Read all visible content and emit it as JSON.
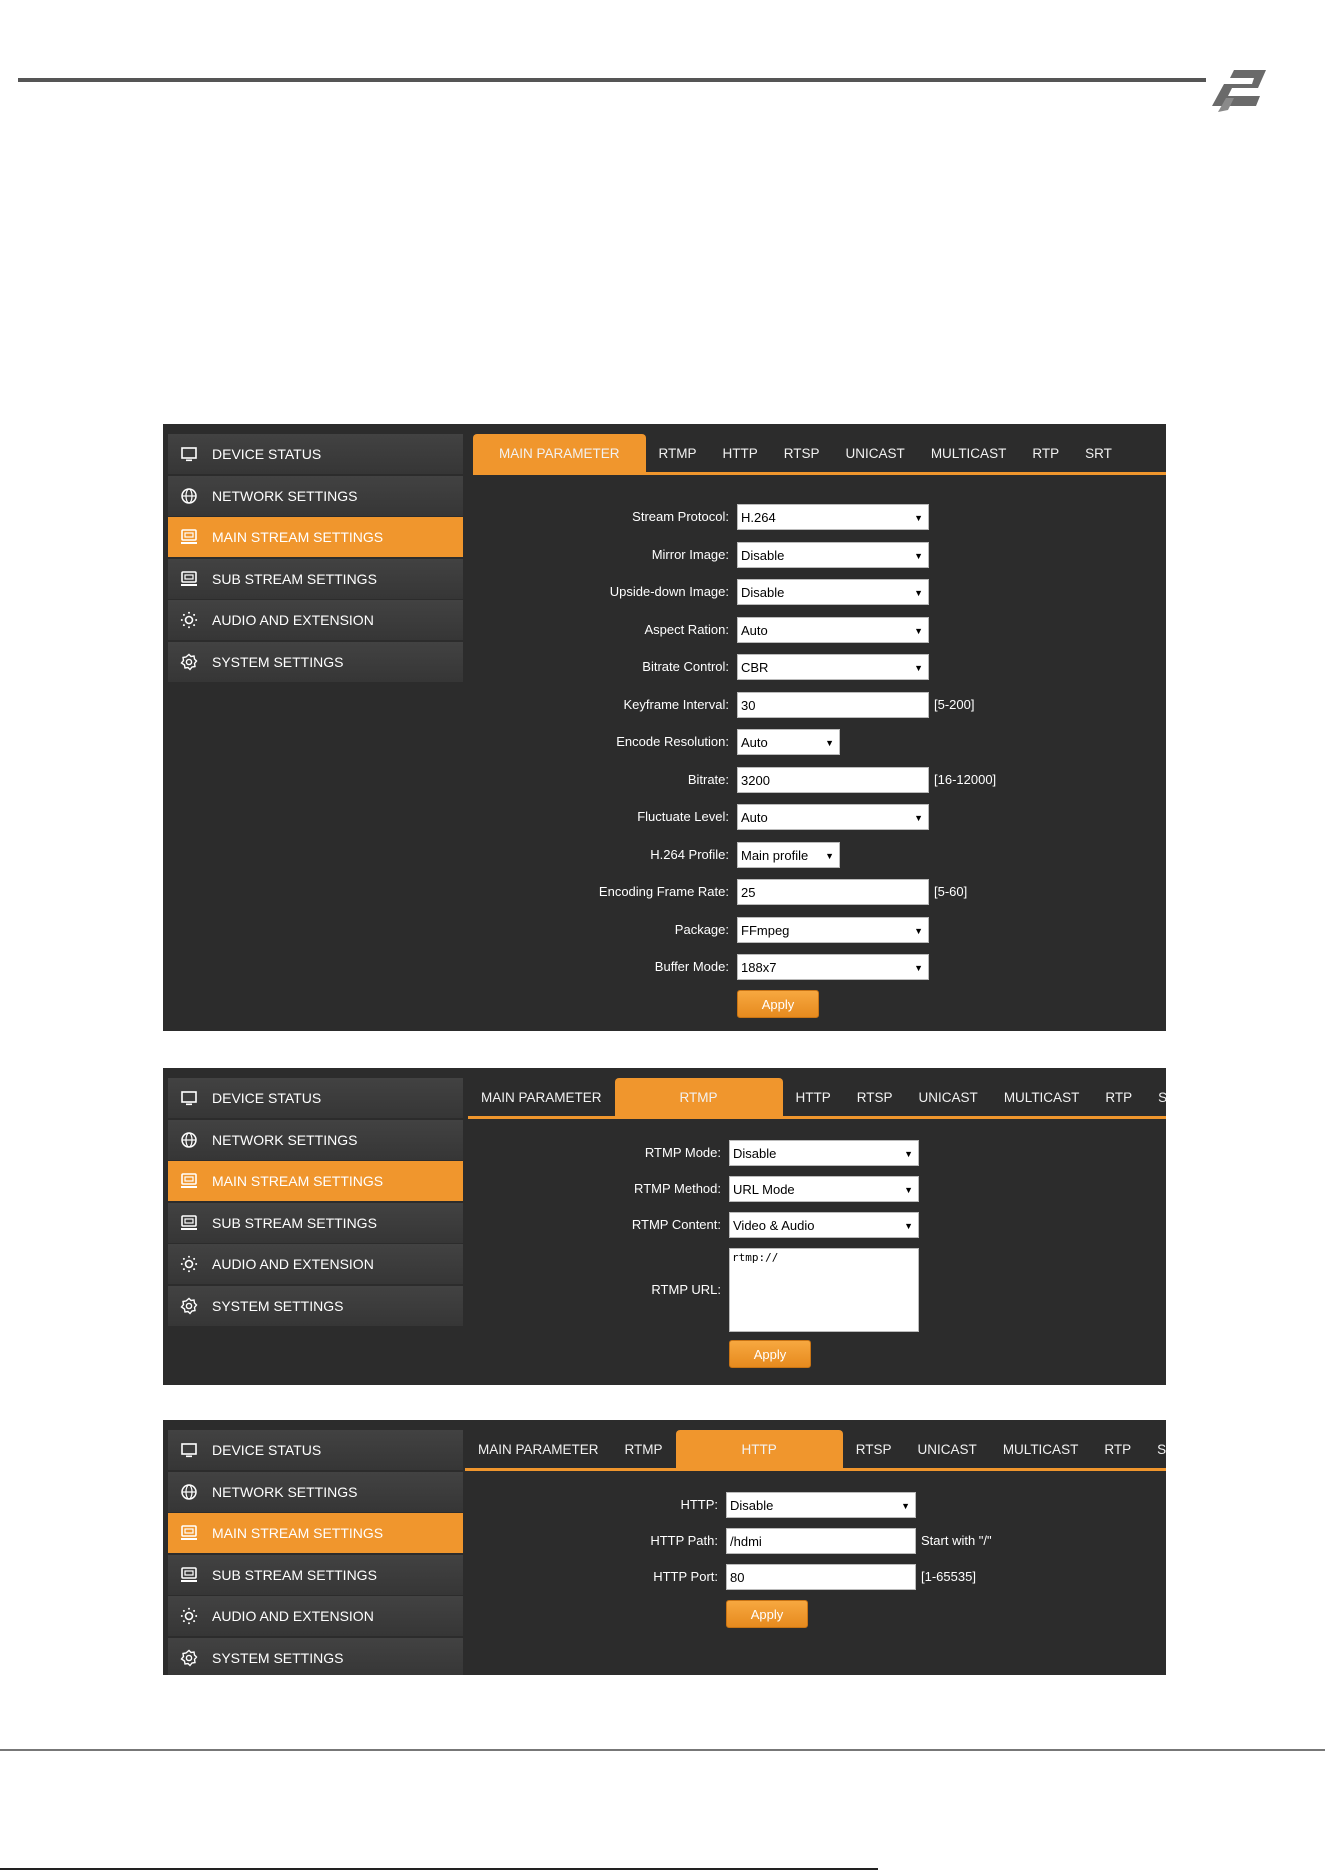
{
  "sidebar_items": [
    "DEVICE STATUS",
    "NETWORK SETTINGS",
    "MAIN STREAM SETTINGS",
    "SUB STREAM SETTINGS",
    "AUDIO AND EXTENSION",
    "SYSTEM SETTINGS"
  ],
  "sidebar_icons": [
    "monitor-icon",
    "globe-icon",
    "stream-icon",
    "stream-icon",
    "gear-dots-icon",
    "gear-icon"
  ],
  "active_sidebar": "MAIN STREAM SETTINGS",
  "tabs": [
    "MAIN PARAMETER",
    "RTMP",
    "HTTP",
    "RTSP",
    "UNICAST",
    "MULTICAST",
    "RTP",
    "SRT"
  ],
  "accent_color": "#f0962d",
  "panel1": {
    "active_tab": "MAIN PARAMETER",
    "fields": [
      {
        "label": "Stream Protocol:",
        "value": "H.264",
        "type": "select"
      },
      {
        "label": "Mirror Image:",
        "value": "Disable",
        "type": "select"
      },
      {
        "label": "Upside-down Image:",
        "value": "Disable",
        "type": "select"
      },
      {
        "label": "Aspect Ration:",
        "value": "Auto",
        "type": "select"
      },
      {
        "label": "Bitrate Control:",
        "value": "CBR",
        "type": "select"
      },
      {
        "label": "Keyframe Interval:",
        "value": "30",
        "type": "input",
        "hint": "[5-200]"
      },
      {
        "label": "Encode Resolution:",
        "value": "Auto",
        "type": "select-small"
      },
      {
        "label": "Bitrate:",
        "value": "3200",
        "type": "input",
        "hint": "[16-12000]"
      },
      {
        "label": "Fluctuate Level:",
        "value": "Auto",
        "type": "select"
      },
      {
        "label": "H.264 Profile:",
        "value": "Main profile",
        "type": "select-small"
      },
      {
        "label": "Encoding Frame Rate:",
        "value": "25",
        "type": "input",
        "hint": "[5-60]"
      },
      {
        "label": "Package:",
        "value": "FFmpeg",
        "type": "select"
      },
      {
        "label": "Buffer Mode:",
        "value": "188x7",
        "type": "select"
      }
    ],
    "apply": "Apply"
  },
  "panel2": {
    "active_tab": "RTMP",
    "fields": [
      {
        "label": "RTMP Mode:",
        "value": "Disable",
        "type": "select"
      },
      {
        "label": "RTMP Method:",
        "value": "URL Mode",
        "type": "select"
      },
      {
        "label": "RTMP Content:",
        "value": "Video & Audio",
        "type": "select"
      },
      {
        "label": "RTMP URL:",
        "value": "rtmp://",
        "type": "textarea"
      }
    ],
    "apply": "Apply"
  },
  "panel3": {
    "active_tab": "HTTP",
    "fields": [
      {
        "label": "HTTP:",
        "value": "Disable",
        "type": "select"
      },
      {
        "label": "HTTP Path:",
        "value": "/hdmi",
        "type": "input",
        "hint": "Start with \"/\""
      },
      {
        "label": "HTTP Port:",
        "value": "80",
        "type": "input",
        "hint": "[1-65535]"
      }
    ],
    "apply": "Apply"
  }
}
